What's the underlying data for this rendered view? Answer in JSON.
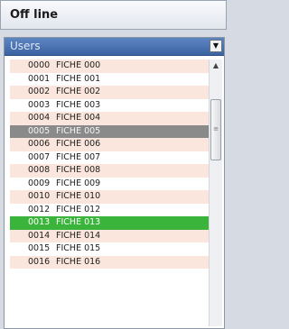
{
  "header": {
    "title": "Off line"
  },
  "combo": {
    "label": "Users",
    "arrow": "chevron-down-icon"
  },
  "list": {
    "rows": [
      {
        "code": "0000",
        "name": "FICHE 000",
        "state": "odd"
      },
      {
        "code": "0001",
        "name": "FICHE 001",
        "state": "even"
      },
      {
        "code": "0002",
        "name": "FICHE 002",
        "state": "odd"
      },
      {
        "code": "0003",
        "name": "FICHE 003",
        "state": "even"
      },
      {
        "code": "0004",
        "name": "FICHE 004",
        "state": "odd"
      },
      {
        "code": "0005",
        "name": "FICHE 005",
        "state": "sel-gray"
      },
      {
        "code": "0006",
        "name": "FICHE 006",
        "state": "odd"
      },
      {
        "code": "0007",
        "name": "FICHE 007",
        "state": "even"
      },
      {
        "code": "0008",
        "name": "FICHE 008",
        "state": "odd"
      },
      {
        "code": "0009",
        "name": "FICHE 009",
        "state": "even"
      },
      {
        "code": "0010",
        "name": "FICHE 010",
        "state": "odd"
      },
      {
        "code": "0012",
        "name": "FICHE 012",
        "state": "even"
      },
      {
        "code": "0013",
        "name": "FICHE 013",
        "state": "sel-green"
      },
      {
        "code": "0014",
        "name": "FICHE 014",
        "state": "odd"
      },
      {
        "code": "0015",
        "name": "FICHE 015",
        "state": "even"
      },
      {
        "code": "0016",
        "name": "FICHE 016",
        "state": "odd"
      }
    ]
  },
  "colors": {
    "row_alt": "#fae6dc",
    "selected_gray": "#8a8a8a",
    "selected_green": "#3ab43a",
    "combo_blue": "#4a72b2"
  }
}
